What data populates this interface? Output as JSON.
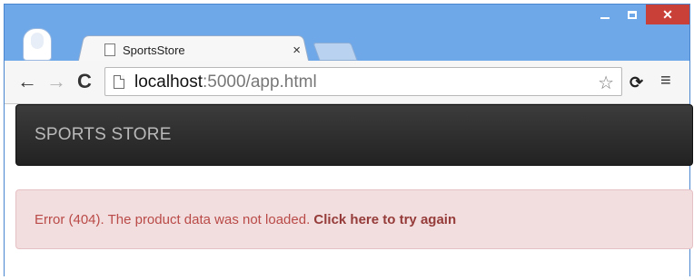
{
  "browser": {
    "tab": {
      "title": "SportsStore",
      "close_glyph": "×"
    },
    "controls": {
      "close_glyph": "✕"
    },
    "nav": {
      "back_glyph": "←",
      "forward_glyph": "→",
      "reload_glyph": "C"
    },
    "address": {
      "host": "localhost",
      "rest": ":5000/app.html",
      "star_glyph": "☆"
    },
    "ext_glyph": "⟳",
    "menu_glyph": "≡"
  },
  "page": {
    "brand": "SPORTS STORE",
    "error": {
      "message": "Error (404). The product data was not loaded. ",
      "link": "Click here to try again"
    }
  },
  "colors": {
    "titlebar": "#6fa8e8",
    "close_button": "#c94038",
    "navbar": "#222222",
    "alert_bg": "#f2dede",
    "alert_text": "#b94a48"
  }
}
